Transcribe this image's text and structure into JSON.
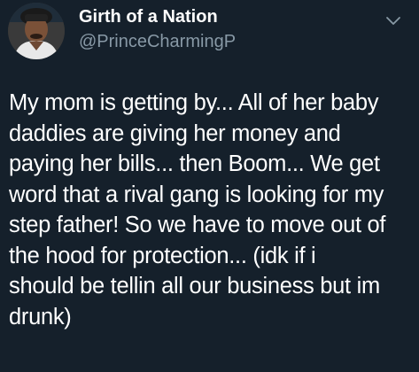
{
  "tweet": {
    "author": {
      "display_name": "Girth of a Nation",
      "handle": "@PrinceCharmingP",
      "avatar_icon": "profile-photo"
    },
    "menu_icon": "chevron-down-icon",
    "text_lines": [
      "My mom is getting by... All of her baby",
      "daddies are giving her money and",
      "paying her bills... then Boom... We get",
      "word that a rival gang is looking for my",
      "step father! So we have to move out of",
      "the hood for protection... (idk if i",
      "should be tellin all our business but im",
      "drunk)"
    ]
  },
  "colors": {
    "background": "#15202b",
    "primary_text": "#ffffff",
    "secondary_text": "#8899a6"
  }
}
